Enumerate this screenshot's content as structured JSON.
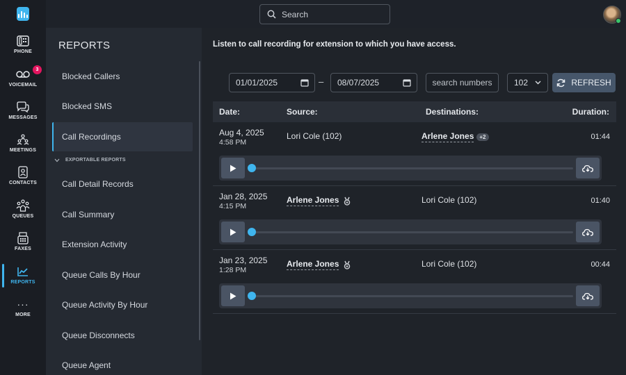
{
  "search": {
    "placeholder": "Search"
  },
  "rail": [
    {
      "label": "PHONE",
      "icon": "phone-icon"
    },
    {
      "label": "VOICEMAIL",
      "icon": "voicemail-icon",
      "badge": "3"
    },
    {
      "label": "MESSAGES",
      "icon": "messages-icon"
    },
    {
      "label": "MEETINGS",
      "icon": "meetings-icon"
    },
    {
      "label": "CONTACTS",
      "icon": "contacts-icon"
    },
    {
      "label": "QUEUES",
      "icon": "queues-icon"
    },
    {
      "label": "FAXES",
      "icon": "fax-icon"
    },
    {
      "label": "REPORTS",
      "icon": "reports-icon",
      "active": true
    },
    {
      "label": "MORE",
      "icon": "more-icon"
    }
  ],
  "sidebar": {
    "title": "REPORTS",
    "items": [
      "Blocked Callers",
      "Blocked SMS",
      "Call Recordings"
    ],
    "section_label": "EXPORTABLE REPORTS",
    "exportable": [
      "Call Detail Records",
      "Call Summary",
      "Extension Activity",
      "Queue Calls By Hour",
      "Queue Activity By Hour",
      "Queue Disconnects",
      "Queue Agent"
    ]
  },
  "main": {
    "intro": "Listen to call recording for extension to which you have access.",
    "filters": {
      "date_from": "01/01/2025",
      "date_to": "08/07/2025",
      "dash": "–",
      "search_placeholder": "search numbers",
      "extension": "102",
      "refresh_label": "REFRESH"
    },
    "columns": {
      "date": "Date:",
      "source": "Source:",
      "destinations": "Destinations:",
      "duration": "Duration:"
    },
    "rows": [
      {
        "date": "Aug 4, 2025",
        "time": "4:58 PM",
        "source": "Lori Cole (102)",
        "destination": "Arlene Jones",
        "extra": "+2",
        "duration": "01:44"
      },
      {
        "date": "Jan 28, 2025",
        "time": "4:15 PM",
        "source": "Arlene Jones",
        "destination": "Lori Cole (102)",
        "duration": "01:40"
      },
      {
        "date": "Jan 23, 2025",
        "time": "1:28 PM",
        "source": "Arlene Jones",
        "destination": "Lori Cole (102)",
        "duration": "00:44"
      }
    ]
  },
  "colors": {
    "accent": "#3fb5ee",
    "badge": "#e3155f",
    "online": "#39c46a"
  }
}
